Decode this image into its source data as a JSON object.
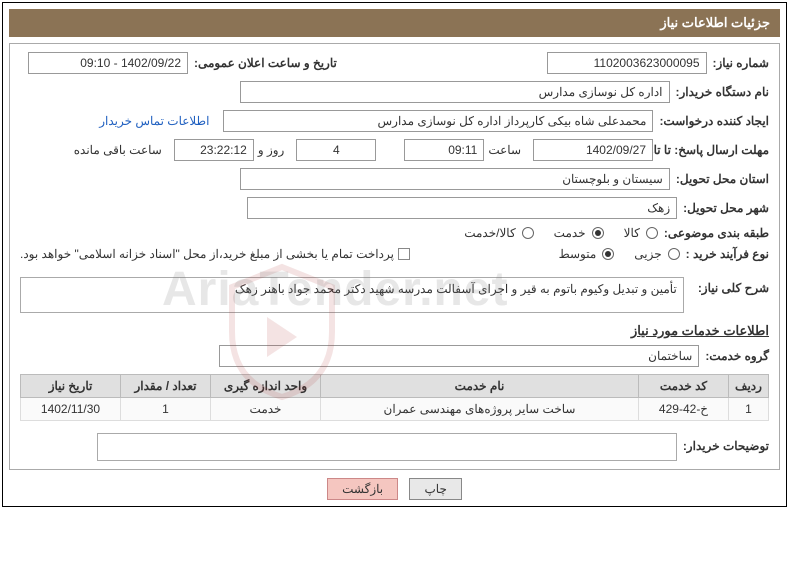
{
  "header": {
    "title": "جزئیات اطلاعات نیاز"
  },
  "fields": {
    "need_number_label": "شماره نیاز:",
    "need_number": "1102003623000095",
    "announce_label": "تاریخ و ساعت اعلان عمومی:",
    "announce_value": "1402/09/22 - 09:10",
    "buyer_org_label": "نام دستگاه خریدار:",
    "buyer_org": "اداره کل نوسازی مدارس",
    "requester_label": "ایجاد کننده درخواست:",
    "requester": "محمدعلی شاه بیکی کارپرداز اداره کل نوسازی مدارس",
    "contact_link": "اطلاعات تماس خریدار",
    "deadline_label": "مهلت ارسال پاسخ: تا تاریخ:",
    "deadline_date": "1402/09/27",
    "time_label": "ساعت",
    "deadline_time": "09:11",
    "remaining_days": "4",
    "days_and": "روز و",
    "remaining_time": "23:22:12",
    "remaining_suffix": "ساعت باقی مانده",
    "province_label": "استان محل تحویل:",
    "province": "سیستان و بلوچستان",
    "city_label": "شهر محل تحویل:",
    "city": "زهک",
    "category_label": "طبقه بندی موضوعی:",
    "radio_goods": "کالا",
    "radio_service": "خدمت",
    "radio_goods_service": "کالا/خدمت",
    "process_label": "نوع فرآیند خرید :",
    "radio_partial": "جزیی",
    "radio_medium": "متوسط",
    "payment_note": "پرداخت تمام یا بخشی از مبلغ خرید،از محل \"اسناد خزانه اسلامی\" خواهد بود.",
    "need_desc_label": "شرح کلی نیاز:",
    "need_desc": "تأمین و تبدیل وکیوم باتوم به قیر و اجرای آسفالت مدرسه شهید دکتر محمد جواد باهنر زهک",
    "services_section": "اطلاعات خدمات مورد نیاز",
    "service_group_label": "گروه خدمت:",
    "service_group": "ساختمان",
    "buyer_comment_label": "توضیحات خریدار:"
  },
  "table": {
    "headers": {
      "row": "ردیف",
      "code": "کد خدمت",
      "name": "نام خدمت",
      "unit": "واحد اندازه گیری",
      "qty": "تعداد / مقدار",
      "date": "تاریخ نیاز"
    },
    "rows": [
      {
        "row": "1",
        "code": "خ-42-429",
        "name": "ساخت سایر پروژه‌های مهندسی عمران",
        "unit": "خدمت",
        "qty": "1",
        "date": "1402/11/30"
      }
    ]
  },
  "buttons": {
    "print": "چاپ",
    "back": "بازگشت"
  },
  "watermark": "AriaTender.net"
}
